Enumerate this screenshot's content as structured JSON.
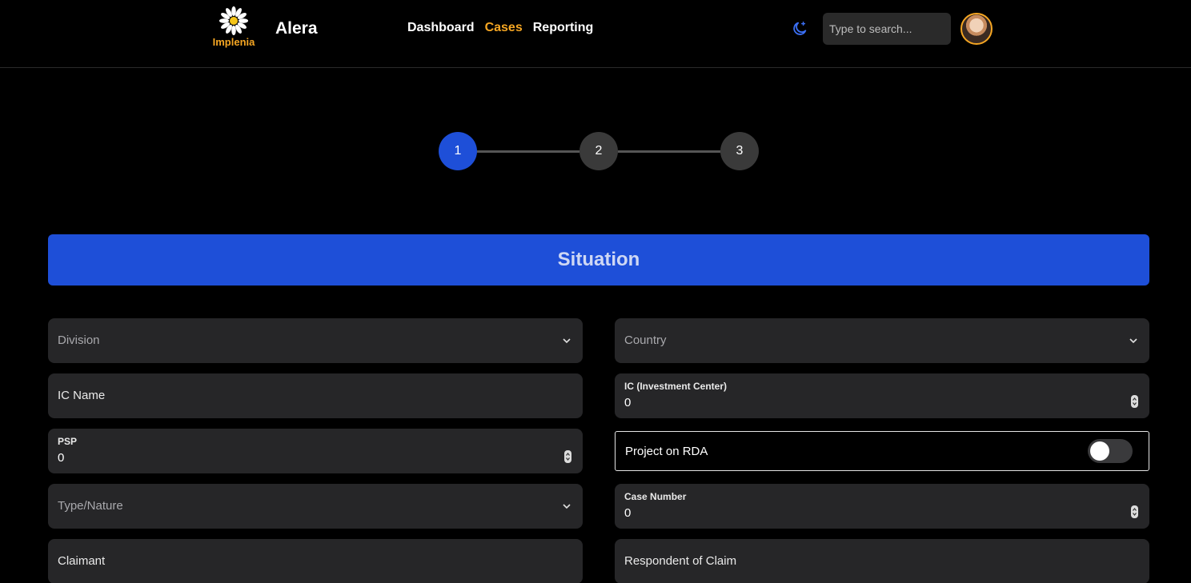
{
  "brand": {
    "logo_text": "Implenia",
    "app_title": "Alera",
    "accent_color": "#f5a623",
    "primary_color": "#1e4fd8"
  },
  "nav": {
    "items": [
      {
        "label": "Dashboard",
        "active": false
      },
      {
        "label": "Cases",
        "active": true
      },
      {
        "label": "Reporting",
        "active": false
      }
    ]
  },
  "header": {
    "theme_icon": "moon-icon",
    "search_placeholder": "Type to search..."
  },
  "stepper": {
    "steps": [
      "1",
      "2",
      "3"
    ],
    "current": 1
  },
  "section": {
    "title": "Situation"
  },
  "form": {
    "division": {
      "placeholder": "Division"
    },
    "country": {
      "placeholder": "Country"
    },
    "ic_name": {
      "label": "IC Name"
    },
    "ic_investment_center": {
      "label": "IC (Investment Center)",
      "value": "0"
    },
    "psp": {
      "label": "PSP",
      "value": "0"
    },
    "project_on_rda": {
      "label": "Project on RDA",
      "checked": false
    },
    "type_nature": {
      "placeholder": "Type/Nature"
    },
    "case_number": {
      "label": "Case Number",
      "value": "0"
    },
    "claimant": {
      "label": "Claimant"
    },
    "respondent_of_claim": {
      "label": "Respondent of Claim"
    }
  }
}
